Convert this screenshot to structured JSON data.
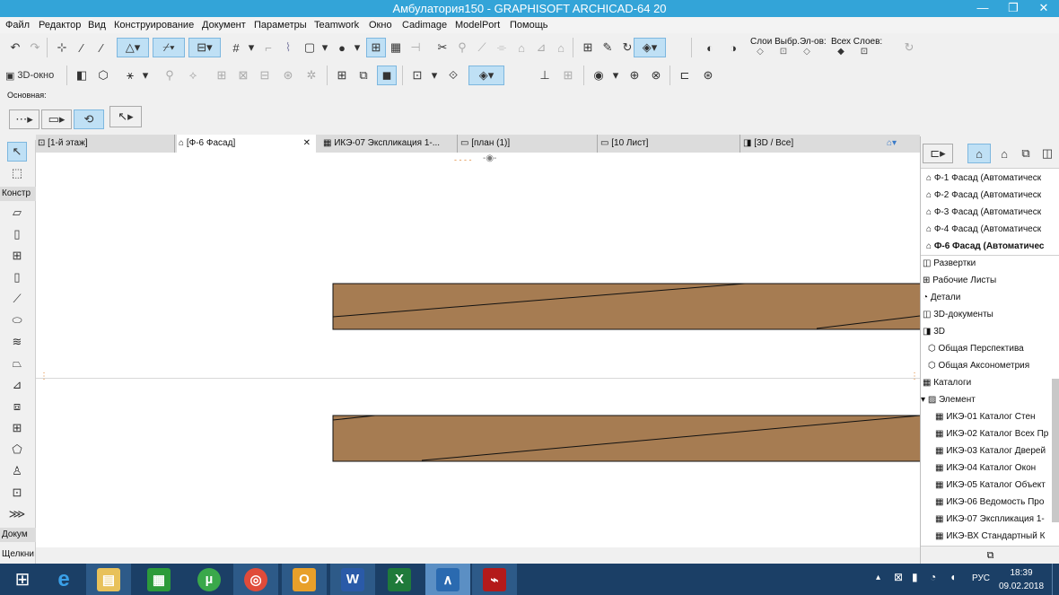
{
  "window": {
    "title": "Амбулатория150 - GRAPHISOFT ARCHICAD-64 20"
  },
  "menu": [
    "Файл",
    "Редактор",
    "Вид",
    "Конструирование",
    "Документ",
    "Параметры",
    "Teamwork",
    "Окно",
    "Cadimage",
    "ModelPort",
    "Помощь"
  ],
  "toolbar": {
    "layers_label": "Слои Выбр.Эл-ов:",
    "all_layers_label": "Всех Слоев:",
    "view3d_label": "3D-окно",
    "basic_label": "Основная:"
  },
  "tabs": [
    {
      "label": "[1-й этаж]"
    },
    {
      "label": "[Ф-6 Фасад]"
    },
    {
      "label": "ИКЭ-07 Экспликация 1-..."
    },
    {
      "label": "[план (1)]"
    },
    {
      "label": "[10 Лист]"
    },
    {
      "label": "[3D / Все]"
    }
  ],
  "left_toolbox": {
    "construct_label": "Констр",
    "document_label": "Докум",
    "status_text": "Щелкни"
  },
  "navigator": {
    "items": [
      {
        "label": "Ф-1 Фасад (Автоматическ"
      },
      {
        "label": "Ф-2 Фасад (Автоматическ"
      },
      {
        "label": "Ф-3 Фасад (Автоматическ"
      },
      {
        "label": "Ф-4 Фасад (Автоматическ"
      },
      {
        "label": "Ф-6 Фасад (Автоматичес"
      },
      {
        "label": "Развертки"
      },
      {
        "label": "Рабочие Листы"
      },
      {
        "label": "Детали"
      },
      {
        "label": "3D-документы"
      },
      {
        "label": "3D"
      },
      {
        "label": "Общая Перспектива"
      },
      {
        "label": "Общая Аксонометрия"
      },
      {
        "label": "Каталоги"
      },
      {
        "label": "Элемент"
      },
      {
        "label": "ИКЭ-01 Каталог Стен"
      },
      {
        "label": "ИКЭ-02 Каталог Всех Пр"
      },
      {
        "label": "ИКЭ-03 Каталог Дверей"
      },
      {
        "label": "ИКЭ-04 Каталог Окон"
      },
      {
        "label": "ИКЭ-05 Каталог Объект"
      },
      {
        "label": "ИКЭ-06 Ведомость Про"
      },
      {
        "label": "ИКЭ-07 Экспликация 1-"
      },
      {
        "label": "ИКЭ-ВХ Стандартный К"
      }
    ]
  },
  "taskbar": {
    "lang": "РУС",
    "time": "18:39",
    "date": "09.02.2018",
    "apps": [
      "e",
      "▤",
      "▦",
      "µ",
      "◎",
      "O",
      "W",
      "X",
      "∧",
      "⌁"
    ]
  },
  "colors": {
    "title_bg": "#33a4d8",
    "beam_fill": "#a67c52",
    "taskbar_bg": "#1b3f66",
    "active_tool": "#bfe0f5"
  }
}
